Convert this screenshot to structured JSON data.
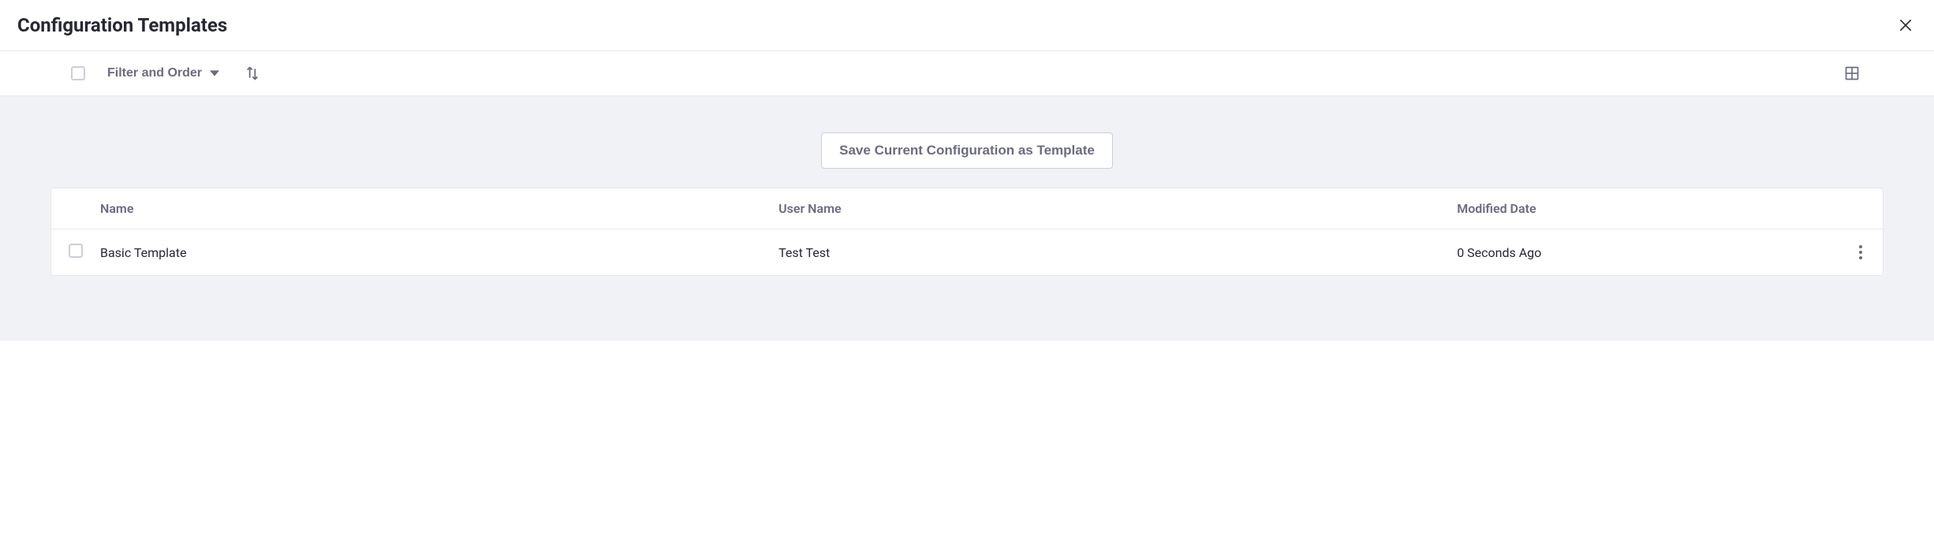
{
  "header": {
    "title": "Configuration Templates"
  },
  "toolbar": {
    "filter_label": "Filter and Order"
  },
  "main": {
    "save_button_label": "Save Current Configuration as Template"
  },
  "table": {
    "columns": {
      "name": "Name",
      "user": "User Name",
      "modified": "Modified Date"
    },
    "rows": [
      {
        "name": "Basic Template",
        "user": "Test Test",
        "modified": "0 Seconds Ago"
      }
    ]
  }
}
